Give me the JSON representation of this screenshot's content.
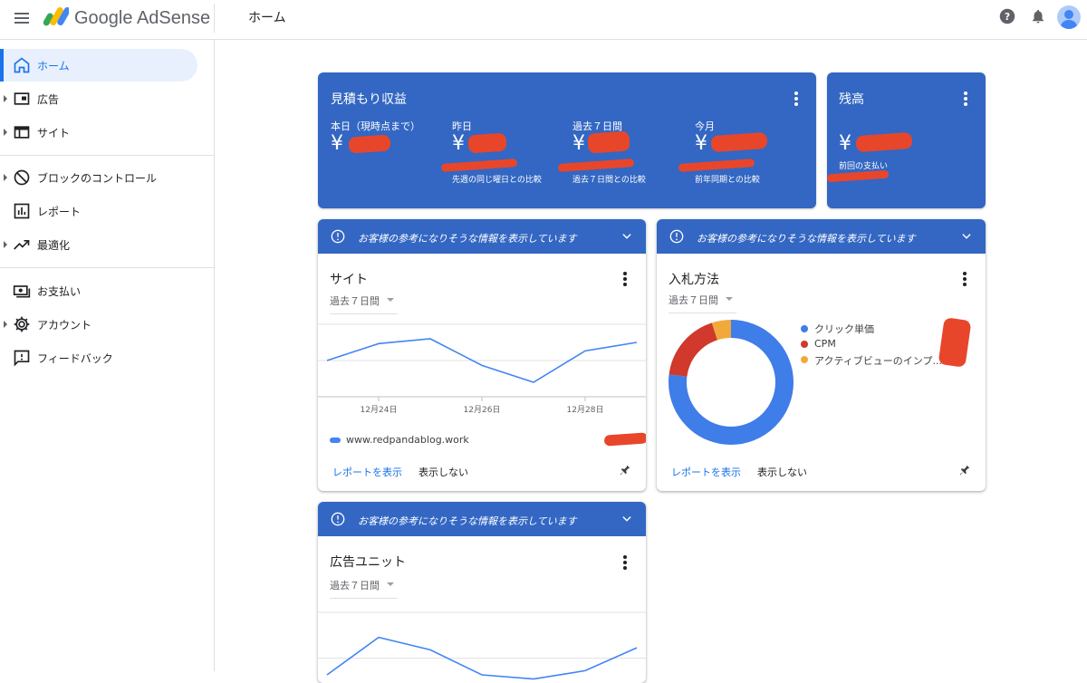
{
  "app": {
    "brand": "Google AdSense",
    "page_title": "ホーム"
  },
  "sidebar": {
    "items": [
      {
        "label": "ホーム",
        "icon": "home-icon",
        "active": true
      },
      {
        "label": "広告",
        "icon": "ads-icon"
      },
      {
        "label": "サイト",
        "icon": "sites-icon"
      },
      {
        "label": "ブロックのコントロール",
        "icon": "block-icon"
      },
      {
        "label": "レポート",
        "icon": "reports-icon"
      },
      {
        "label": "最適化",
        "icon": "trending-up-icon"
      },
      {
        "label": "お支払い",
        "icon": "payments-icon"
      },
      {
        "label": "アカウント",
        "icon": "gear-icon"
      },
      {
        "label": "フィードバック",
        "icon": "feedback-icon"
      }
    ]
  },
  "earnings": {
    "title": "見積もり収益",
    "metrics": [
      {
        "label": "本日（現時点まで）",
        "value": "¥",
        "compare": ""
      },
      {
        "label": "昨日",
        "value": "¥",
        "compare": "先週の同じ曜日との比較"
      },
      {
        "label": "過去７日間",
        "value": "¥",
        "compare": "過去７日間との比較"
      },
      {
        "label": "今月",
        "value": "¥",
        "compare": "前年同期との比較"
      }
    ]
  },
  "balance": {
    "title": "残高",
    "value": "¥",
    "sub": "前回の支払い"
  },
  "info_banner": "お客様の参考になりそうな情報を表示しています",
  "sites_card": {
    "title": "サイト",
    "range": "過去７日間",
    "site_name": "www.redpandablog.work",
    "view_report": "レポートを表示",
    "hide": "表示しない"
  },
  "bidding_card": {
    "title": "入札方法",
    "range": "過去７日間",
    "view_report": "レポートを表示",
    "hide": "表示しない"
  },
  "ad_units_card": {
    "title": "広告ユニット",
    "range": "過去７日間"
  },
  "chart_data": [
    {
      "type": "line",
      "x": [
        "12月23日",
        "12月24日",
        "12月25日",
        "12月26日",
        "12月27日",
        "12月28日",
        "12月29日"
      ],
      "x_tick_labels": [
        "12月24日",
        "12月26日",
        "12月28日"
      ],
      "series": [
        {
          "name": "www.redpandablog.work",
          "values": [
            3.0,
            4.4,
            4.8,
            2.6,
            1.2,
            3.8,
            4.5
          ],
          "color": "#4285f4"
        }
      ],
      "ylim": [
        0,
        6
      ],
      "grid": true
    },
    {
      "type": "pie",
      "donut": true,
      "categories": [
        "クリック単価",
        "CPM",
        "アクティブビューのインプ..."
      ],
      "values": [
        77,
        18,
        5
      ],
      "colors": [
        "#3f7de8",
        "#d0392b",
        "#f2a93b"
      ],
      "legend": "right"
    },
    {
      "type": "line",
      "series": [
        {
          "name": "",
          "values": [
            1.0,
            2.8,
            2.2,
            1.0,
            0.8,
            1.2,
            2.3
          ],
          "color": "#4285f4"
        }
      ],
      "ylim": [
        0,
        4
      ],
      "grid": true
    }
  ]
}
